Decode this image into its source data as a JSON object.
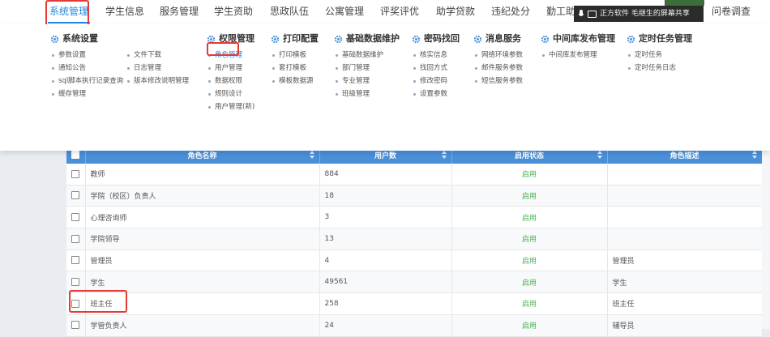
{
  "topnav": {
    "items": [
      {
        "label": "系统管理"
      },
      {
        "label": "学生信息"
      },
      {
        "label": "服务管理"
      },
      {
        "label": "学生资助"
      },
      {
        "label": "思政队伍"
      },
      {
        "label": "公寓管理"
      },
      {
        "label": "评奖评优"
      },
      {
        "label": "助学贷款"
      },
      {
        "label": "违纪处分"
      },
      {
        "label": "勤工助学"
      },
      {
        "label": "问卷调查"
      }
    ]
  },
  "share_bar": {
    "text": "正方软件 毛继生的屏幕共享"
  },
  "menu": {
    "groups": [
      {
        "title": "系统设置",
        "col1": [
          "参数设置",
          "通知公告",
          "sql脚本执行记录查询",
          "缓存管理"
        ],
        "col2": [
          "文件下载",
          "日志管理",
          "版本修改说明管理"
        ]
      },
      {
        "title": "权限管理",
        "col1": [
          "角色管理",
          "用户管理",
          "数据权限",
          "规则设计",
          "用户管理(新)"
        ]
      },
      {
        "title": "打印配置",
        "col1": [
          "打印模板",
          "套打模板",
          "模板数据源"
        ]
      },
      {
        "title": "基础数据维护",
        "col1": [
          "基础数据维护",
          "部门管理",
          "专业管理",
          "班级管理"
        ]
      },
      {
        "title": "密码找回",
        "col1": [
          "核实信息",
          "找回方式",
          "修改密码",
          "设置参数"
        ]
      },
      {
        "title": "消息服务",
        "col1": [
          "网络环境参数",
          "邮件服务参数",
          "短信服务参数"
        ]
      },
      {
        "title": "中间库发布管理",
        "col1": [
          "中间库发布管理"
        ]
      },
      {
        "title": "定时任务管理",
        "col1": [
          "定时任务",
          "定时任务日志"
        ]
      }
    ]
  },
  "table": {
    "headers": [
      "角色名称",
      "用户数",
      "启用状态",
      "角色描述"
    ],
    "rows": [
      {
        "name": "教师",
        "count": "884",
        "status": "启用",
        "desc": ""
      },
      {
        "name": "学院（校区）负责人",
        "count": "18",
        "status": "启用",
        "desc": ""
      },
      {
        "name": "心理咨询师",
        "count": "3",
        "status": "启用",
        "desc": ""
      },
      {
        "name": "学院领导",
        "count": "13",
        "status": "启用",
        "desc": ""
      },
      {
        "name": "管理员",
        "count": "4",
        "status": "启用",
        "desc": "管理员"
      },
      {
        "name": "学生",
        "count": "49561",
        "status": "启用",
        "desc": "学生"
      },
      {
        "name": "班主任",
        "count": "258",
        "status": "启用",
        "desc": "班主任"
      },
      {
        "name": "学管负责人",
        "count": "24",
        "status": "启用",
        "desc": "辅导员"
      }
    ]
  },
  "colors": {
    "accent": "#1e88e5",
    "header_bg": "#4a90d9",
    "status_green": "#4caf50",
    "highlight": "#e53935"
  }
}
